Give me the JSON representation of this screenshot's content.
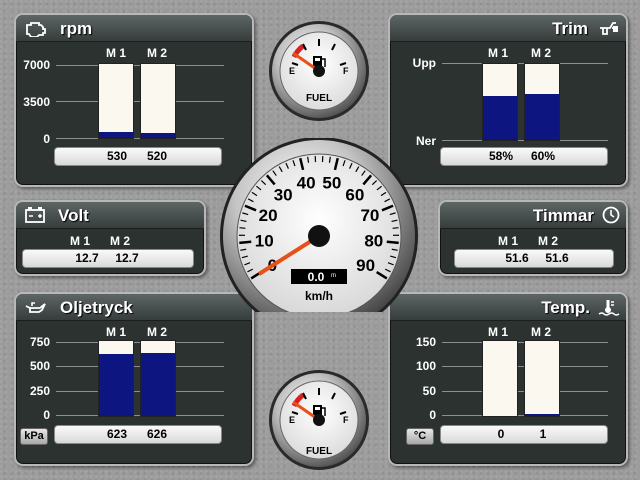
{
  "rpm": {
    "title": "rpm",
    "icon": "engine-icon",
    "m1_label": "M 1",
    "m2_label": "M 2",
    "ticks": [
      "7000",
      "3500",
      "0"
    ],
    "scale_max": 7000,
    "m1_value": 530,
    "m2_value": 520,
    "m1_text": "530",
    "m2_text": "520"
  },
  "trim": {
    "title": "Trim",
    "icon": "boat-trim-icon",
    "m1_label": "M 1",
    "m2_label": "M 2",
    "top_label": "Upp",
    "bottom_label": "Ner",
    "m1_pct": 58,
    "m2_pct": 60,
    "m1_text": "58%",
    "m2_text": "60%"
  },
  "volt": {
    "title": "Volt",
    "icon": "battery-icon",
    "m1_label": "M 1",
    "m2_label": "M 2",
    "m1_text": "12.7",
    "m2_text": "12.7"
  },
  "timmar": {
    "title": "Timmar",
    "icon": "clock-icon",
    "m1_label": "M 1",
    "m2_label": "M 2",
    "m1_text": "51.6",
    "m2_text": "51.6"
  },
  "oil": {
    "title": "Oljetryck",
    "icon": "oil-can-icon",
    "m1_label": "M 1",
    "m2_label": "M 2",
    "ticks": [
      "750",
      "500",
      "250",
      "0"
    ],
    "scale_max": 750,
    "m1_value": 623,
    "m2_value": 626,
    "m1_text": "623",
    "m2_text": "626",
    "unit": "kPa"
  },
  "temp": {
    "title": "Temp.",
    "icon": "water-temp-icon",
    "m1_label": "M 1",
    "m2_label": "M 2",
    "ticks": [
      "150",
      "100",
      "50",
      "0"
    ],
    "scale_max": 150,
    "m1_value": 0,
    "m2_value": 1,
    "m1_text": "0",
    "m2_text": "1",
    "unit": "°C"
  },
  "fuel_top": {
    "label": "FUEL",
    "empty": "E",
    "full": "F",
    "level": 0.05
  },
  "fuel_bottom": {
    "label": "FUEL",
    "empty": "E",
    "full": "F",
    "level": 0.05
  },
  "speed": {
    "ticks": [
      "0",
      "10",
      "20",
      "30",
      "40",
      "50",
      "60",
      "70",
      "80",
      "90"
    ],
    "value": 0.0,
    "readout": "0.0",
    "readout_sup": "m",
    "unit": "km/h",
    "colors": {
      "needle": "#e8501a",
      "redzone": "#d82020"
    }
  },
  "colors": {
    "bar_fill": "#0d1680",
    "bar_empty": "#fbf8f0",
    "panel": "#2b3230"
  }
}
